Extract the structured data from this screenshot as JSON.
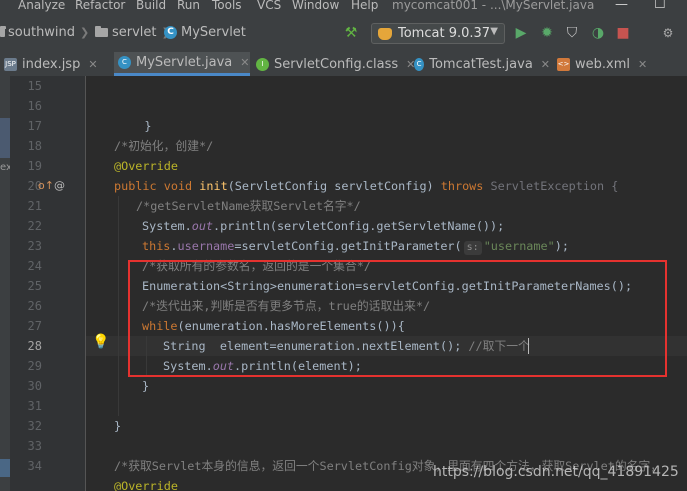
{
  "menu": {
    "items": [
      "Analyze",
      "Refactor",
      "Build",
      "Run",
      "Tools",
      "VCS",
      "Window",
      "Help"
    ],
    "window_title": "mycomcat001 - ...\\MyServlet.java"
  },
  "breadcrumbs": [
    "southwind",
    "servlet",
    "MyServlet"
  ],
  "run_config": {
    "label": "Tomcat 9.0.37"
  },
  "tabs": [
    {
      "label": "index.jsp",
      "icon": "jsp-file-icon",
      "active": false
    },
    {
      "label": "MyServlet.java",
      "icon": "class-icon",
      "active": true
    },
    {
      "label": "ServletConfig.class",
      "icon": "interface-icon",
      "active": false
    },
    {
      "label": "TomcatTest.java",
      "icon": "class-icon",
      "active": false
    },
    {
      "label": "web.xml",
      "icon": "xml-file-icon",
      "active": false
    }
  ],
  "side_label": "exp",
  "editor": {
    "line_numbers": [
      "15",
      "16",
      "17",
      "18",
      "19",
      "20",
      "21",
      "22",
      "23",
      "24",
      "25",
      "26",
      "27",
      "28",
      "29",
      "30",
      "31",
      "32",
      "33",
      "34"
    ],
    "current_line": "28",
    "param_hint": "s:",
    "lines": {
      "l16": "}",
      "l18": "/*初始化，创建*/",
      "l19": "@Override",
      "l20_kw1": "public",
      "l20_kw2": "void",
      "l20_name": "init",
      "l20_sig": "(ServletConfig servletConfig) ",
      "l20_throws": "throws",
      "l20_exc": "ServletException {",
      "l21": "/*getServletName获取Servlet名字*/",
      "l22_a": "System.",
      "l22_out": "out",
      "l22_b": ".println(servletConfig.getServletName());",
      "l23_this": "this",
      "l23_dot": ".",
      "l23_field": "username",
      "l23_rest": "=servletConfig.getInitParameter(",
      "l23_str": "\"username\"",
      "l23_end": ");",
      "l24": "/*获取所有的参数名，返回的是一个集合*/",
      "l25": "Enumeration<String>enumeration=servletConfig.getInitParameterNames();",
      "l26": "/*迭代出来,判断是否有更多节点，true的话取出来*/",
      "l27_kw": "while",
      "l27_rest": "(enumeration.hasMoreElements()){",
      "l28_code": "String  element=enumeration.nextElement(); ",
      "l28_comment": "//取下一个",
      "l29_a": "System.",
      "l29_out": "out",
      "l29_b": ".println(element);",
      "l30": "}",
      "l32": "}",
      "l34_a": "/*获取Servlet本身的信息，返回一个ServletConfig对象，里面有四个方法，获取Servlet的名字，",
      "l35": "@Override"
    }
  },
  "watermark": "https://blog.csdn.net/qq_41891425",
  "colors": {
    "keyword": "#cc7832",
    "comment": "#808080",
    "annotation": "#bbb529",
    "string": "#6a8759",
    "field": "#9876aa",
    "highlight_box": "#e5322f"
  }
}
